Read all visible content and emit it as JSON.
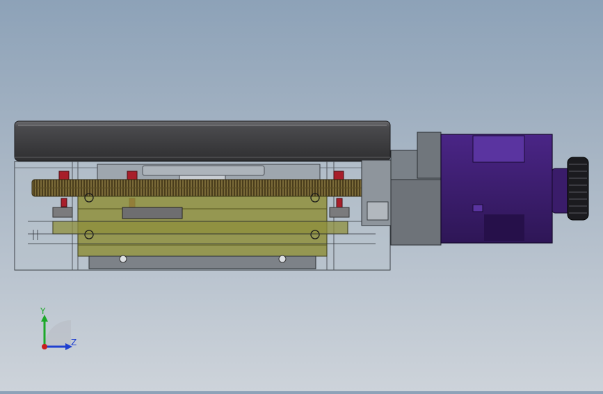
{
  "viewport": {
    "colors": {
      "bg_top": "#8da2b8",
      "bg_bottom": "#cdd3da",
      "turntable_top": "#3e3e40",
      "gear": "#6b5a2e",
      "plate": "#8f8f3c",
      "motor": "#3d1e6e",
      "knob": "#1b1b1f",
      "screw": "#a81e2a"
    }
  },
  "triad": {
    "y_label": "Y",
    "z_label": "Z",
    "y_color": "#1ca829",
    "z_color": "#1f3fd0"
  }
}
